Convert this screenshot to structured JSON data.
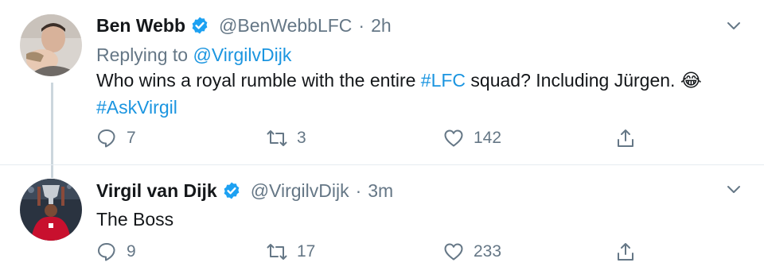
{
  "tweets": [
    {
      "name": "Ben Webb",
      "handle": "@BenWebbLFC",
      "dot": "·",
      "time": "2h",
      "replying_prefix": "Replying to ",
      "replying_to": "@VirgilvDijk",
      "body_text": "Who wins a royal rumble with the entire ",
      "body_hashtag1": "#LFC",
      "body_text2": " squad? Including Jürgen. ",
      "body_emoji": "😂",
      "body_hashtag2": "#AskVirgil",
      "replies": "7",
      "retweets": "3",
      "likes": "142"
    },
    {
      "name": "Virgil van Dijk",
      "handle": "@VirgilvDijk",
      "dot": "·",
      "time": "3m",
      "body_text": "The Boss",
      "replies": "9",
      "retweets": "17",
      "likes": "233"
    }
  ],
  "colors": {
    "link": "#1b95e0",
    "secondary_text": "#657786",
    "verified": "#1da1f2",
    "divider": "#e6ecf0",
    "thread_line": "#ccd6dd"
  },
  "icons": [
    "verified-badge-icon",
    "chevron-down-icon",
    "reply-icon",
    "retweet-icon",
    "like-icon",
    "share-icon"
  ]
}
